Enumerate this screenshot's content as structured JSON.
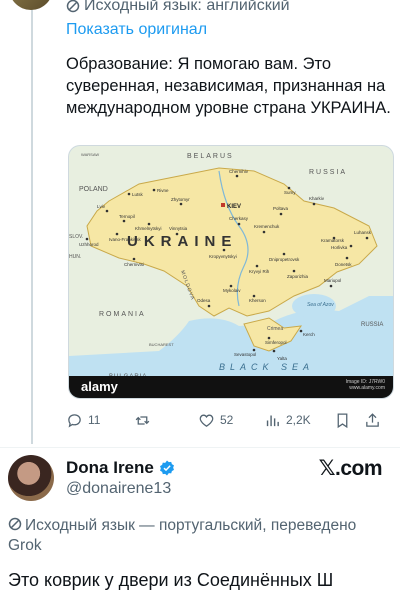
{
  "tweet1": {
    "source_language": "Исходный язык: английский",
    "show_original": "Показать оригинал",
    "text": "Образование: Я помогаю вам. Это суверенная, независимая, признанная на международном уровне страна УКРАИНА.",
    "map": {
      "country_label": "UKRAINE",
      "capital_label": "KIEV",
      "neighbors": {
        "belarus": "BELARUS",
        "poland": "POLAND",
        "russia_top": "RUSSIA",
        "russia_right": "RUSSIA",
        "romania": "ROMANIA",
        "bulgaria": "BULGARIA",
        "moldova": "MOLDOVA",
        "slovakia": "SLOV.",
        "hungary": "HUN.",
        "warsaw": "WARSAW",
        "bucharest": "BUCHAREST"
      },
      "seas": {
        "black_sea": "BLACK SEA",
        "sea_of_azov": "Sea of Azov"
      },
      "cities": {
        "lutsk": "Lutsk",
        "rivne": "Rivne",
        "lviv": "Lviv",
        "zhytomyr": "Zhytomyr",
        "ternopil": "Ternopil",
        "khmelnytskyi": "Khmelnytskyi",
        "ivano_frankivsk": "Ivano-Frankivsk",
        "uzhhorod": "Uzhhorod",
        "chernivtsi": "Chernivtsi",
        "vinnytsia": "Vinnytsia",
        "chernihiv": "Chernihiv",
        "sumy": "Sumy",
        "poltava": "Poltava",
        "kharkiv": "Kharkiv",
        "cherkasy": "Cherkasy",
        "kremenchuk": "Kremenchuk",
        "kropyvnytskyi": "Kropyvnytskyi",
        "dnipro": "Dnipropetrovsk",
        "luhansk": "Luhansk",
        "donetsk": "Donetsk",
        "zaporizhia": "Zaporizhia",
        "kryvyi_rih": "Kryvyi Rih",
        "mykolaiv": "Mykolaiv",
        "odesa": "Odesa",
        "kherson": "Kherson",
        "mariupol": "Mariupol",
        "simferopol": "Simferopol",
        "sevastopol": "Sevastopol",
        "kerch": "Kerch",
        "yalta": "Yalta",
        "horlivka": "Horlivka",
        "kramatorsk": "Kramatorsk"
      },
      "crimea_label": "Crimea",
      "watermark": "alamy",
      "image_id": "Image ID: J7RW0",
      "site": "www.alamy.com"
    },
    "actions": {
      "replies": "11",
      "retweets": "",
      "likes": "52",
      "views": "2,2K"
    }
  },
  "tweet2": {
    "author_name": "Dona Irene",
    "handle": "@donairene13",
    "platform_logo": "𝕏.com",
    "source_language": "Исходный язык — португальский, переведено Grok",
    "text": "Это коврик у двери из Соединённых Ш"
  },
  "colors": {
    "link": "#1d9bf0",
    "muted": "#536471",
    "verified": "#1d9bf0",
    "ukraine_fill": "#f6e7a5",
    "sea": "#bfe1f2"
  },
  "icons": {
    "translate": "translate-icon",
    "reply": "reply-icon",
    "retweet": "retweet-icon",
    "like": "heart-icon",
    "views": "views-icon",
    "bookmark": "bookmark-icon",
    "share": "share-icon",
    "verified": "verified-badge-icon"
  }
}
